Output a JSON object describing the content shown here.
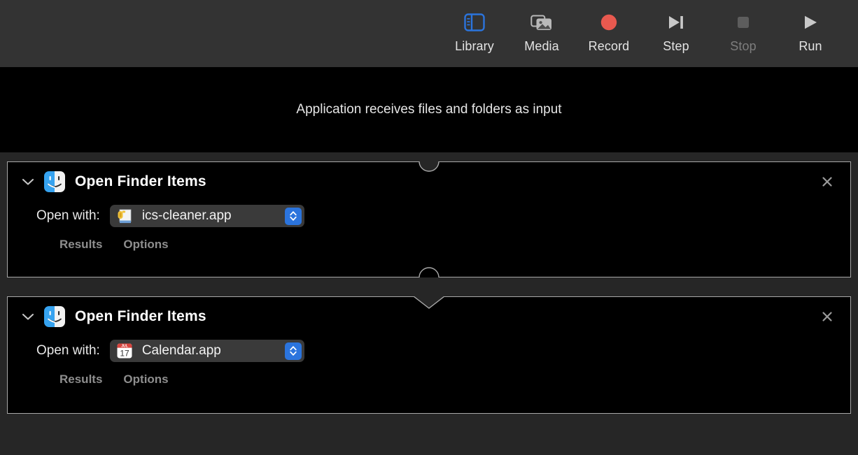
{
  "toolbar": {
    "buttons": [
      {
        "label": "Library",
        "icon": "library-icon",
        "state": "active"
      },
      {
        "label": "Media",
        "icon": "media-icon",
        "state": "normal"
      },
      {
        "label": "Record",
        "icon": "record-icon",
        "state": "normal"
      },
      {
        "label": "Step",
        "icon": "step-icon",
        "state": "normal"
      },
      {
        "label": "Stop",
        "icon": "stop-icon",
        "state": "disabled"
      },
      {
        "label": "Run",
        "icon": "run-icon",
        "state": "normal"
      }
    ]
  },
  "input_banner": {
    "text": "Application receives files and folders as input"
  },
  "actions": [
    {
      "title": "Open Finder Items",
      "icon": "finder-icon",
      "close_icon": "close-icon",
      "disclosure_icon": "chevron-down-icon",
      "row_label": "Open with:",
      "popup_value": "ics-cleaner.app",
      "popup_icon": "automator-app-icon",
      "stepper_icon": "stepper-up-down-icon",
      "results_label": "Results",
      "options_label": "Options"
    },
    {
      "title": "Open Finder Items",
      "icon": "finder-icon",
      "close_icon": "close-icon",
      "disclosure_icon": "chevron-down-icon",
      "row_label": "Open with:",
      "popup_value": "Calendar.app",
      "popup_icon": "calendar-app-icon",
      "calendar_month": "JUL",
      "calendar_day": "17",
      "stepper_icon": "stepper-up-down-icon",
      "results_label": "Results",
      "options_label": "Options"
    }
  ],
  "colors": {
    "toolbar_bg": "#333333",
    "canvas_bg": "#262626",
    "card_bg": "#000000",
    "card_border": "#a8a8a8",
    "accent_blue": "#2b74dd",
    "record_red": "#e8594f",
    "calendar_red": "#d9453f",
    "disabled_gray": "#7d7d7d"
  }
}
